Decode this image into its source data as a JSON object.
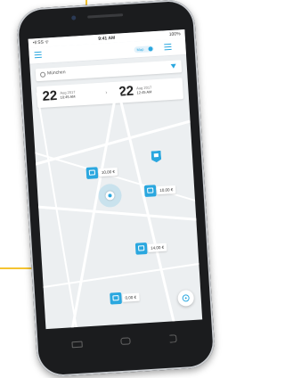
{
  "statusbar": {
    "signal": "•ll SS ᯤ",
    "time": "9:41 AM",
    "battery": "100%"
  },
  "appbar": {
    "toggle_label": "Map"
  },
  "search": {
    "query": "München"
  },
  "dates": {
    "from": {
      "day": "22",
      "month": "Aug 2017",
      "time": "10:45 AM"
    },
    "to": {
      "day": "22",
      "month": "Aug 2017",
      "time": "12:45 AM"
    },
    "arrow": "›"
  },
  "map_pins": [
    {
      "price": "10,00 €"
    },
    {
      "price": "10,00 €"
    },
    {
      "price": "14,00 €"
    },
    {
      "price": "0,00 €"
    }
  ],
  "colors": {
    "accent": "#2aa7df",
    "map_background": "#eceff1",
    "guide_line": "#f5c431"
  }
}
